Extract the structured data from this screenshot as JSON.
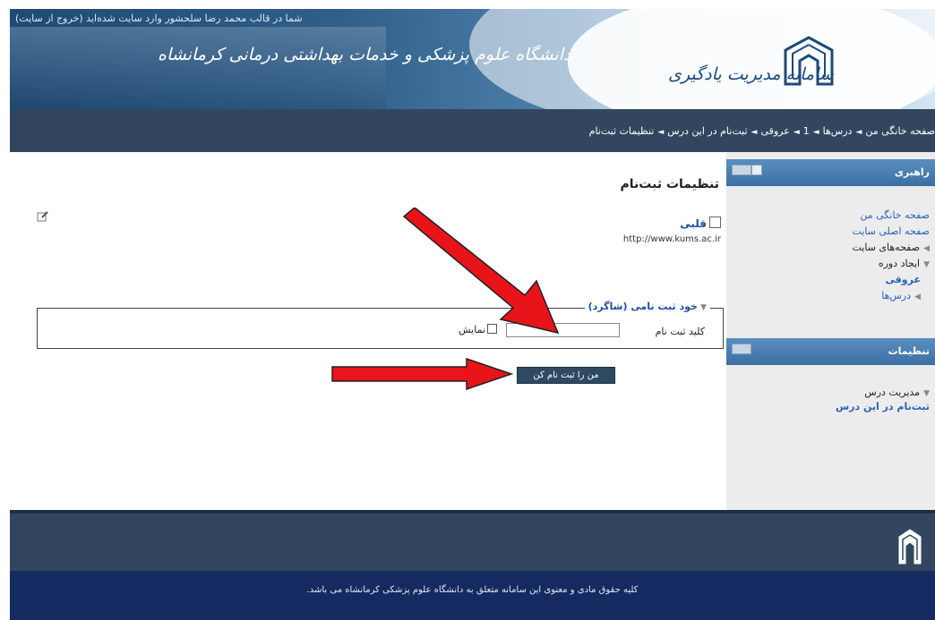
{
  "header": {
    "login_prefix": "شما در قالب محمد رضا سلحشور وارد سایت شده‌اید",
    "logout_label": "(خروج از سایت)",
    "university_title": "دانشگاه علوم پزشکی و خدمات بهداشتی درمانی کرمانشاه",
    "system_title": "سامانه مدیریت یادگیری"
  },
  "breadcrumb": {
    "items": [
      "صفحه خانگی من",
      "درس‌ها",
      "1",
      "عروقی",
      "ثبت‌نام در این درس",
      "تنظیمات ثبت‌نام"
    ],
    "separator": "◄"
  },
  "main": {
    "page_title": "تنظیمات ثبت‌نام",
    "course_name": "قلبی",
    "course_url": "http://www.kums.ac.ir",
    "fieldset_legend": "خود ثبت نامی (شاگرد)",
    "enrolment_key_label": "کلید ثبت نام",
    "enrolment_key_value": "",
    "show_label": "نمایش",
    "enrol_button": "من را ثبت نام کن"
  },
  "sidebar": {
    "navigation": {
      "title": "راهبری",
      "items": [
        "صفحه خانگی من",
        "صفحه اصلی سایت",
        "صفحه‌های سایت",
        "ایجاد دوره",
        "عروقی",
        "درس‌ها"
      ]
    },
    "settings": {
      "title": "تنظیمات",
      "items": [
        "مدیریت درس",
        "ثبت‌نام در این درس"
      ]
    }
  },
  "footer": {
    "copyright": "کلیه حقوق مادی و معنوی این سامانه متعلق به دانشگاه علوم پزشکی کرمانشاه می باشد."
  },
  "colors": {
    "navbar": "#32475f",
    "footer_dark": "#142a60",
    "link": "#2a63b5",
    "arrow": "#e8141a"
  }
}
